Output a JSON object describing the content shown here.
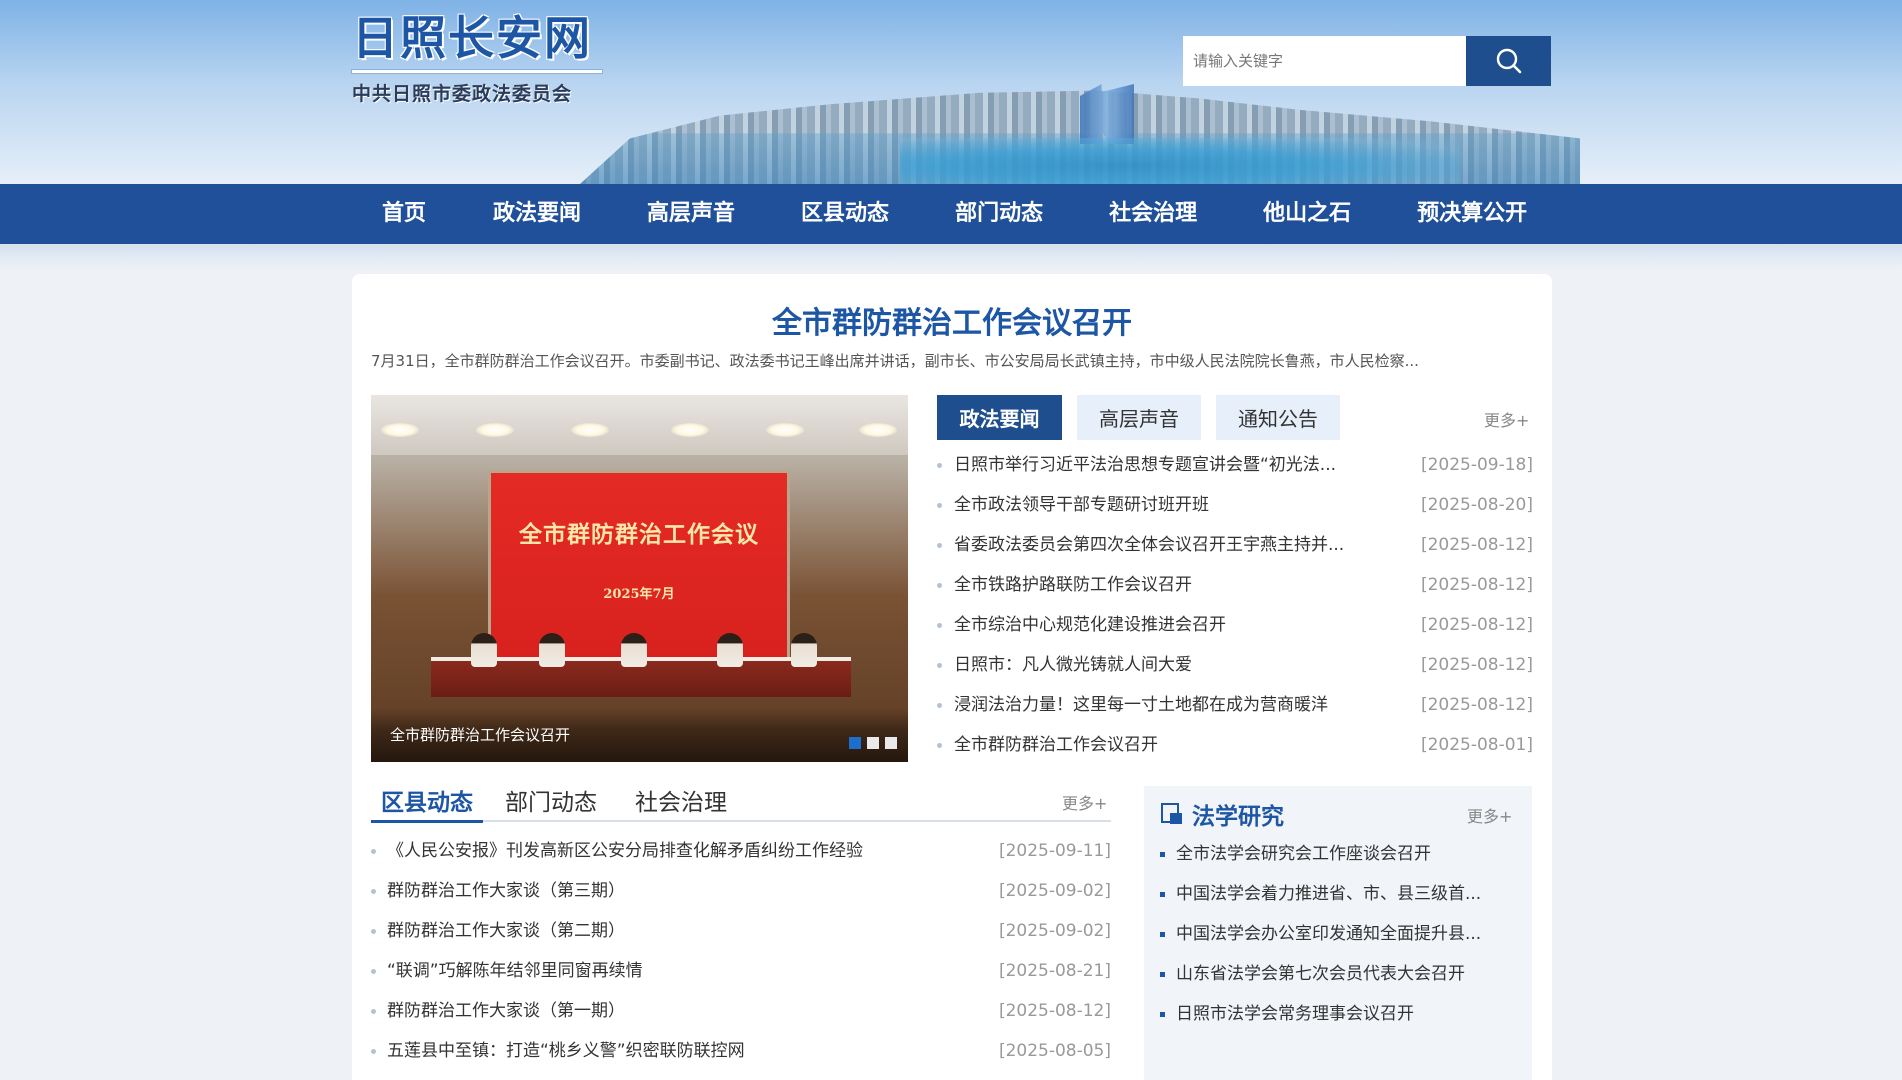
{
  "header": {
    "site_title": "日照长安网",
    "site_subtitle": "中共日照市委政法委员会",
    "search_placeholder": "请输入关键字"
  },
  "nav": {
    "items": [
      "首页",
      "政法要闻",
      "高层声音",
      "区县动态",
      "部门动态",
      "社会治理",
      "他山之石",
      "预决算公开"
    ]
  },
  "headline": {
    "title": "全市群防群治工作会议召开",
    "summary": "7月31日，全市群防群治工作会议召开。市委副书记、政法委书记王峰出席并讲话，副市长、市公安局局长武镇主持，市中级人民法院院长鲁燕，市人民检察..."
  },
  "slider": {
    "screen_title": "全市群防群治工作会议",
    "screen_date": "2025年7月",
    "caption": "全市群防群治工作会议召开",
    "dots": 3,
    "active_dot": 0
  },
  "news_panel": {
    "tabs": [
      "政法要闻",
      "高层声音",
      "通知公告"
    ],
    "active_tab": 0,
    "more": "更多+",
    "items": [
      {
        "title": "日照市举行习近平法治思想专题宣讲会暨“初光法...",
        "date": "[2025-09-18]"
      },
      {
        "title": "全市政法领导干部专题研讨班开班",
        "date": "[2025-08-20]"
      },
      {
        "title": "省委政法委员会第四次全体会议召开王宇燕主持并...",
        "date": "[2025-08-12]"
      },
      {
        "title": "全市铁路护路联防工作会议召开",
        "date": "[2025-08-12]"
      },
      {
        "title": "全市综治中心规范化建设推进会召开",
        "date": "[2025-08-12]"
      },
      {
        "title": "日照市：凡人微光铸就人间大爱",
        "date": "[2025-08-12]"
      },
      {
        "title": "浸润法治力量！这里每一寸土地都在成为营商暖洋",
        "date": "[2025-08-12]"
      },
      {
        "title": "全市群防群治工作会议召开",
        "date": "[2025-08-01]"
      }
    ]
  },
  "county_panel": {
    "tabs": [
      "区县动态",
      "部门动态",
      "社会治理"
    ],
    "active_tab": 0,
    "more": "更多+",
    "items": [
      {
        "title": "《人民公安报》刊发高新区公安分局排查化解矛盾纠纷工作经验",
        "date": "[2025-09-11]"
      },
      {
        "title": "群防群治工作大家谈（第三期）",
        "date": "[2025-09-02]"
      },
      {
        "title": "群防群治工作大家谈（第二期）",
        "date": "[2025-09-02]"
      },
      {
        "title": "“联调”巧解陈年结邻里同窗再续情",
        "date": "[2025-08-21]"
      },
      {
        "title": "群防群治工作大家谈（第一期）",
        "date": "[2025-08-12]"
      },
      {
        "title": "五莲县中至镇：打造“桃乡义警”织密联防联控网",
        "date": "[2025-08-05]"
      }
    ]
  },
  "law_panel": {
    "title": "法学研究",
    "more": "更多+",
    "items": [
      "全市法学会研究会工作座谈会召开",
      "中国法学会着力推进省、市、县三级首...",
      "中国法学会办公室印发通知全面提升县...",
      "山东省法学会第七次会员代表大会召开",
      "日照市法学会常务理事会议召开"
    ]
  },
  "colors": {
    "primary": "#1f4e8e",
    "nav": "#20509a",
    "accent": "#1d56a5"
  }
}
